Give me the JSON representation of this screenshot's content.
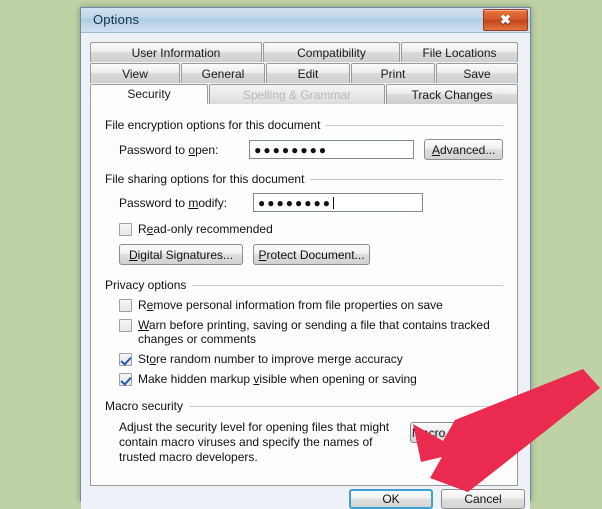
{
  "window": {
    "title": "Options",
    "close_icon": "close-x-icon"
  },
  "tabs": {
    "row1": [
      {
        "label": "User Information",
        "state": "inactive"
      },
      {
        "label": "Compatibility",
        "state": "inactive"
      },
      {
        "label": "File Locations",
        "state": "inactive"
      }
    ],
    "row2": [
      {
        "label": "View",
        "state": "inactive"
      },
      {
        "label": "General",
        "state": "inactive"
      },
      {
        "label": "Edit",
        "state": "inactive"
      },
      {
        "label": "Print",
        "state": "inactive"
      },
      {
        "label": "Save",
        "state": "inactive"
      }
    ],
    "row3": [
      {
        "label": "Security",
        "state": "active"
      },
      {
        "label": "Spelling & Grammar",
        "state": "disabled"
      },
      {
        "label": "Track Changes",
        "state": "inactive"
      }
    ]
  },
  "encryption_group": {
    "heading": "File encryption options for this document",
    "password_open_label": "Password to open:",
    "password_open_value": "●●●●●●●●",
    "advanced_button": "Advanced..."
  },
  "sharing_group": {
    "heading": "File sharing options for this document",
    "password_modify_label": "Password to modify:",
    "password_modify_value": "●●●●●●●●",
    "readonly_label": "Read-only recommended",
    "readonly_checked": false,
    "digital_signatures_button": "Digital Signatures...",
    "protect_document_button": "Protect Document..."
  },
  "privacy_group": {
    "heading": "Privacy options",
    "options": [
      {
        "label": "Remove personal information from file properties on save",
        "checked": false
      },
      {
        "label": "Warn before printing, saving or sending a file that contains tracked changes or comments",
        "checked": false
      },
      {
        "label": "Store random number to improve merge accuracy",
        "checked": true
      },
      {
        "label": "Make hidden markup visible when opening or saving",
        "checked": true
      }
    ]
  },
  "macro_group": {
    "heading": "Macro security",
    "description": "Adjust the security level for opening files that might contain macro viruses and specify the names of trusted macro developers.",
    "macro_security_button": "Macro Security..."
  },
  "footer": {
    "ok_label": "OK",
    "cancel_label": "Cancel"
  },
  "annotation": {
    "arrow_color": "#ea2a4e",
    "arrow_name": "red-pointer-arrow",
    "points_at": "OK"
  },
  "colors": {
    "desktop_background": "#bed2a5",
    "dialog_background": "#eef1f8",
    "panel_background": "#fdfdfe",
    "titlebar_blue": "#bfd6ea",
    "close_button_red": "#d4542a",
    "default_button_outline": "#3e9fd6",
    "checkmark_blue": "#2b57a8"
  }
}
